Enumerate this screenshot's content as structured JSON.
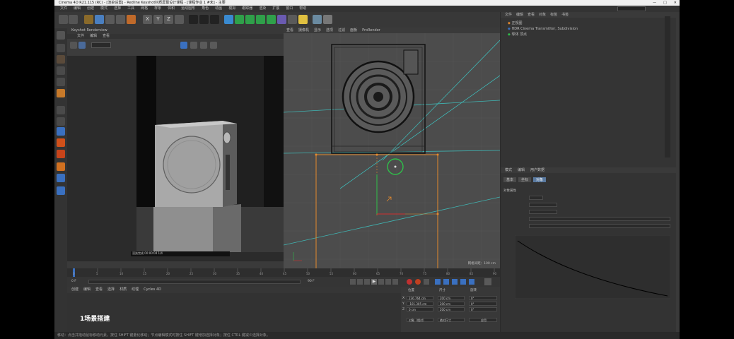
{
  "window": {
    "title": "Cinema 4D R21.115 (RC) - [渲染设置] - Redline Keyshot材质屏幕设计课程 - [课程作业 1 #未] - 主要"
  },
  "menus": [
    "文件",
    "编辑",
    "创建",
    "模式",
    "选择",
    "工具",
    "网格",
    "样条",
    "体积",
    "运动图形",
    "角色",
    "动画",
    "模拟",
    "跟踪器",
    "渲染",
    "扩展",
    "窗口",
    "帮助"
  ],
  "viewport_left": {
    "title": "Keyshot Renderview",
    "menu": [
      "文件",
      "编辑",
      "查看"
    ],
    "statusbar_text": "渲染完成 00:00:04  1/4"
  },
  "viewport_right": {
    "menu": [
      "查看",
      "摄像机",
      "显示",
      "选项",
      "过滤",
      "面板",
      "ProRender"
    ],
    "label": "正视图",
    "grid_text": "网格间距：100 cm"
  },
  "object_manager": {
    "menu": [
      "文件",
      "编辑",
      "查看",
      "对象",
      "标签",
      "书签"
    ],
    "rows": [
      "正视图",
      "HDR Cinema Transmitter, Subdivision",
      "球体 顶点"
    ]
  },
  "attributes": {
    "tabs": [
      "模式",
      "编辑",
      "用户数据"
    ],
    "section_tabs": [
      "基本",
      "坐标",
      "对象"
    ],
    "title": "对象属性"
  },
  "timeline": {
    "ticks": [
      "0",
      "5",
      "10",
      "15",
      "20",
      "25",
      "30",
      "35",
      "40",
      "45",
      "50",
      "55",
      "60",
      "65",
      "70",
      "75",
      "80",
      "85",
      "90"
    ],
    "current_frame": "0 F",
    "end_frame": "90 F"
  },
  "materials_menu": [
    "创建",
    "编辑",
    "查看",
    "选择",
    "材质",
    "纹理",
    "Cycles 4D"
  ],
  "overlay_caption": "1场景搭建",
  "coords": {
    "headers": [
      "位置",
      "尺寸",
      "旋转"
    ],
    "pos": [
      "236.764 cm",
      "-101.305 cm",
      "0 cm"
    ],
    "size": [
      "200 cm",
      "200 cm",
      "200 cm"
    ],
    "rot": [
      "0°",
      "0°",
      "0°"
    ],
    "mode1": "对象（相对）",
    "mode2": "绝对尺寸",
    "apply": "应用"
  },
  "statusbar": "移动：点击并拖动鼠标移动元素。按住 SHIFT 键量化移动；节点编辑模式时按住 SHIFT 键增加选择对象；按住 CTRL 键减少选择对象。",
  "colors": {
    "accent_orange": "#e58a2d",
    "selection_green": "#2fbf4a",
    "axis_cyan": "#3fb6b4"
  }
}
